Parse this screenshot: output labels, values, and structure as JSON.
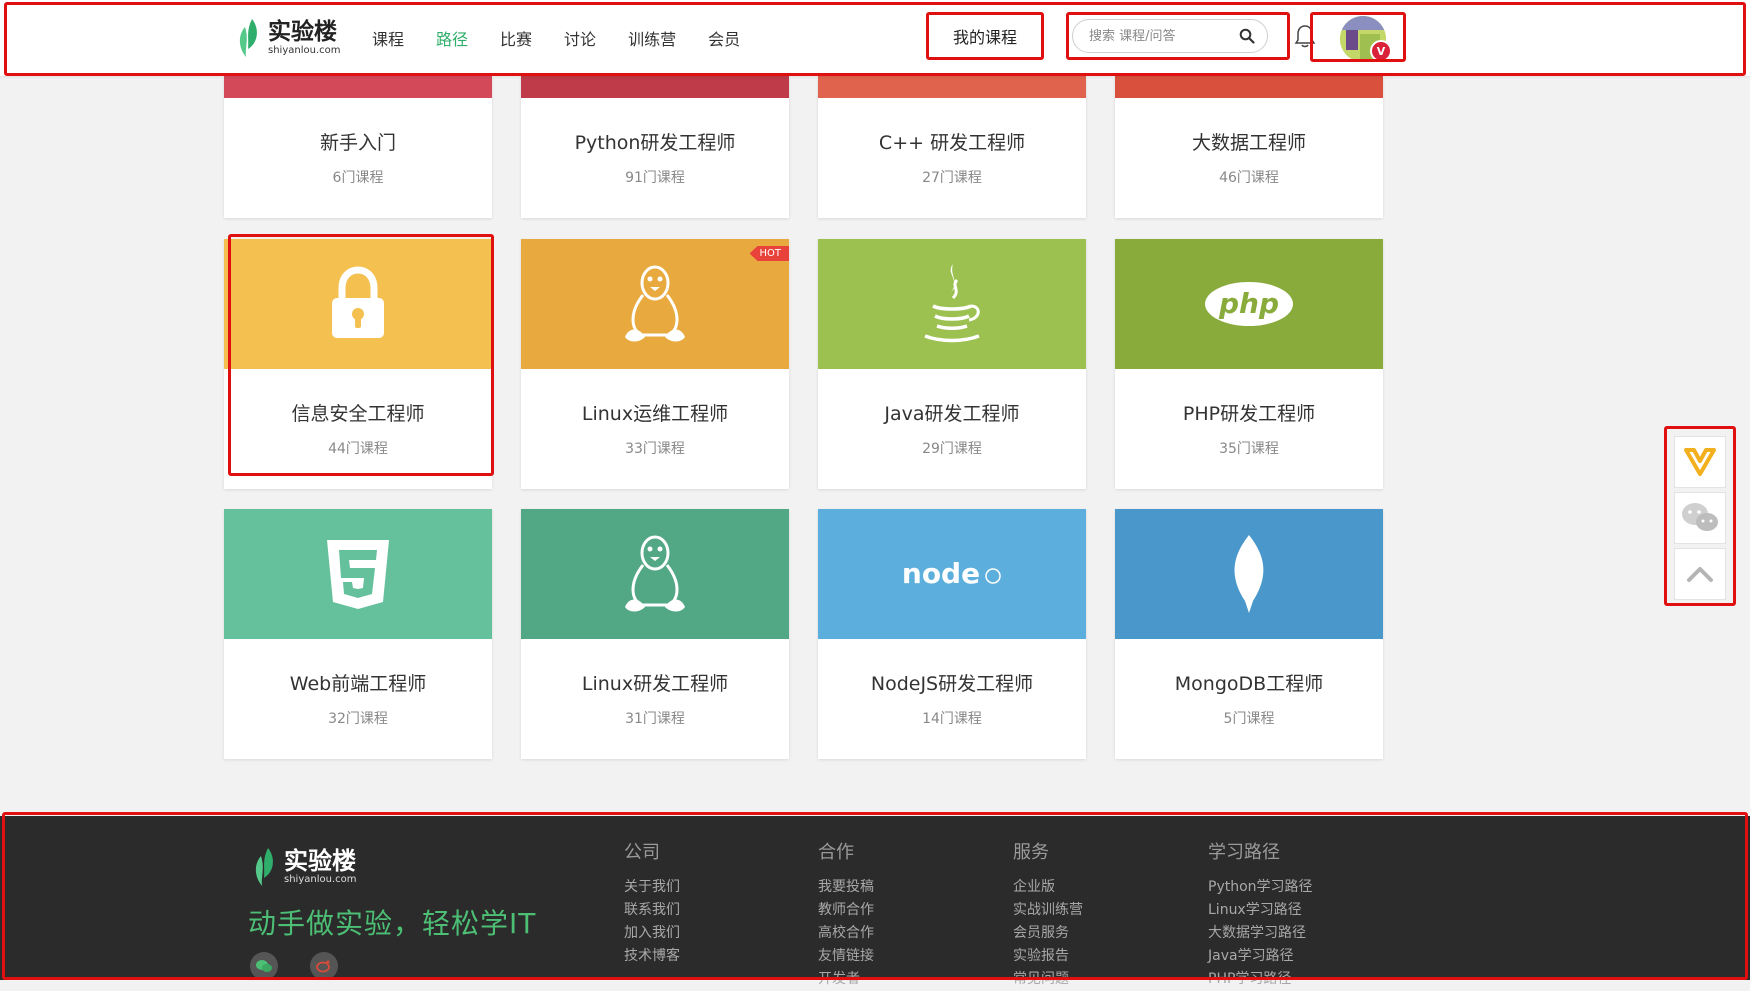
{
  "header": {
    "logo": {
      "cn": "实验楼",
      "en": "shiyanlou.com"
    },
    "nav": [
      "课程",
      "路径",
      "比赛",
      "讨论",
      "训练营",
      "会员"
    ],
    "nav_active": "路径",
    "my_courses": "我的课程",
    "search_placeholder": "搜索 课程/问答",
    "avatar_badge": "V"
  },
  "paths_row1": [
    {
      "title": "新手入门",
      "count": "6门课程",
      "color": "#d4495a"
    },
    {
      "title": "Python研发工程师",
      "count": "91门课程",
      "color": "#bf3b49"
    },
    {
      "title": "C++ 研发工程师",
      "count": "27门课程",
      "color": "#e0634d"
    },
    {
      "title": "大数据工程师",
      "count": "46门课程",
      "color": "#d9513d"
    }
  ],
  "paths_row2": [
    {
      "title": "信息安全工程师",
      "count": "44门课程",
      "color": "#f4c050",
      "icon": "lock-icon"
    },
    {
      "title": "Linux运维工程师",
      "count": "33门课程",
      "color": "#e8aa3f",
      "icon": "penguin-icon",
      "tag": "HOT"
    },
    {
      "title": "Java研发工程师",
      "count": "29门课程",
      "color": "#9cc151",
      "icon": "java-icon"
    },
    {
      "title": "PHP研发工程师",
      "count": "35门课程",
      "color": "#88ab3c",
      "icon": "php-icon",
      "icon_text": "php"
    }
  ],
  "paths_row3": [
    {
      "title": "Web前端工程师",
      "count": "32门课程",
      "color": "#65c09c",
      "icon": "html5-icon"
    },
    {
      "title": "Linux研发工程师",
      "count": "31门课程",
      "color": "#52a785",
      "icon": "penguin-icon"
    },
    {
      "title": "NodeJS研发工程师",
      "count": "14门课程",
      "color": "#5caedc",
      "icon": "nodejs-icon",
      "icon_text": "node"
    },
    {
      "title": "MongoDB工程师",
      "count": "5门课程",
      "color": "#4a98cb",
      "icon": "mongodb-leaf-icon"
    }
  ],
  "float_bar": [
    "vip-icon",
    "wechat-icon",
    "back-to-top-icon"
  ],
  "footer": {
    "logo": {
      "cn": "实验楼",
      "en": "shiyanlou.com"
    },
    "slogan": "动手做实验，轻松学IT",
    "columns": [
      {
        "title": "公司",
        "links": [
          "关于我们",
          "联系我们",
          "加入我们",
          "技术博客"
        ]
      },
      {
        "title": "合作",
        "links": [
          "我要投稿",
          "教师合作",
          "高校合作",
          "友情链接",
          "开发者"
        ]
      },
      {
        "title": "服务",
        "links": [
          "企业版",
          "实战训练营",
          "会员服务",
          "实验报告",
          "常见问题"
        ]
      },
      {
        "title": "学习路径",
        "links": [
          "Python学习路径",
          "Linux学习路径",
          "大数据学习路径",
          "Java学习路径",
          "PHP学习路径"
        ]
      }
    ]
  },
  "colors": {
    "accent_green": "#2fae6b",
    "highlight_red": "#e01010"
  }
}
